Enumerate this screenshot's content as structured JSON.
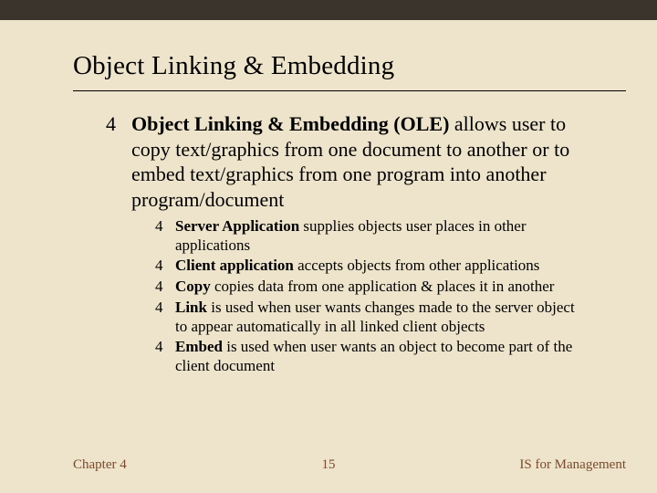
{
  "title": "Object Linking & Embedding",
  "bullet_marker": "4",
  "main": {
    "bold": "Object Linking & Embedding (OLE)",
    "rest": " allows user to copy text/graphics from one document to another or to embed text/graphics from one program into another program/document"
  },
  "subs": [
    {
      "bold": "Server Application",
      "rest": " supplies objects user places in other applications"
    },
    {
      "bold": "Client application",
      "rest": " accepts objects from other applications"
    },
    {
      "bold": "Copy",
      "rest": " copies data from one application & places it in another"
    },
    {
      "bold": "Link",
      "rest": " is used when user wants changes made to the server object to appear automatically in all linked client objects"
    },
    {
      "bold": "Embed",
      "rest": " is used when user wants an object to become part of the client document"
    }
  ],
  "footer": {
    "left": "Chapter 4",
    "center": "15",
    "right": "IS  for Management"
  }
}
